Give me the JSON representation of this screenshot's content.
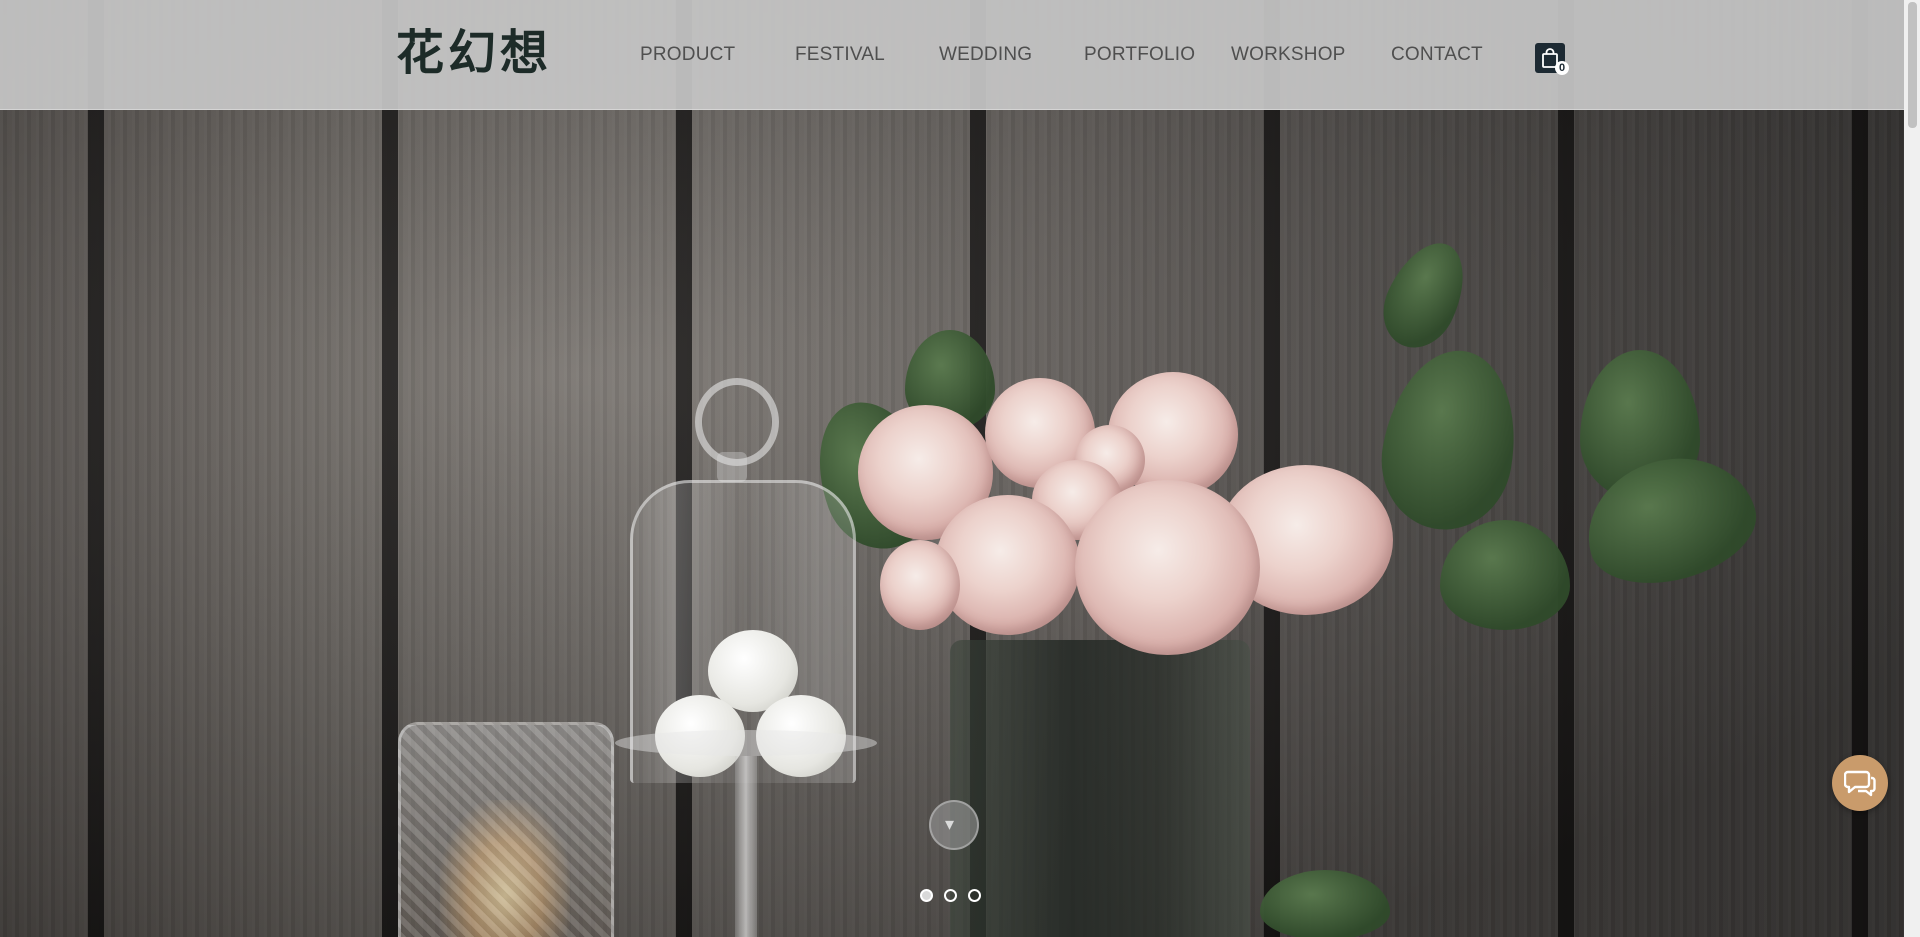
{
  "header": {
    "logo_text": "花幻想",
    "nav": [
      {
        "label": "PRODUCT"
      },
      {
        "label": "FESTIVAL"
      },
      {
        "label": "WEDDING"
      },
      {
        "label": "PORTFOLIO"
      },
      {
        "label": "WORKSHOP"
      },
      {
        "label": "CONTACT"
      }
    ],
    "cart": {
      "icon": "shopping-bag-icon",
      "count": "0"
    }
  },
  "hero": {
    "scroll_icon": "chevron-down-icon",
    "slides": {
      "count": 3,
      "active": 1
    }
  },
  "chat": {
    "icon": "chat-bubbles-icon"
  },
  "colors": {
    "header_bg": "#c6c6c6",
    "nav_text": "#4f4f4f",
    "logo": "#1d2b28",
    "cart_bg": "#1d2a33",
    "chat_bg": "#c99b6b"
  }
}
